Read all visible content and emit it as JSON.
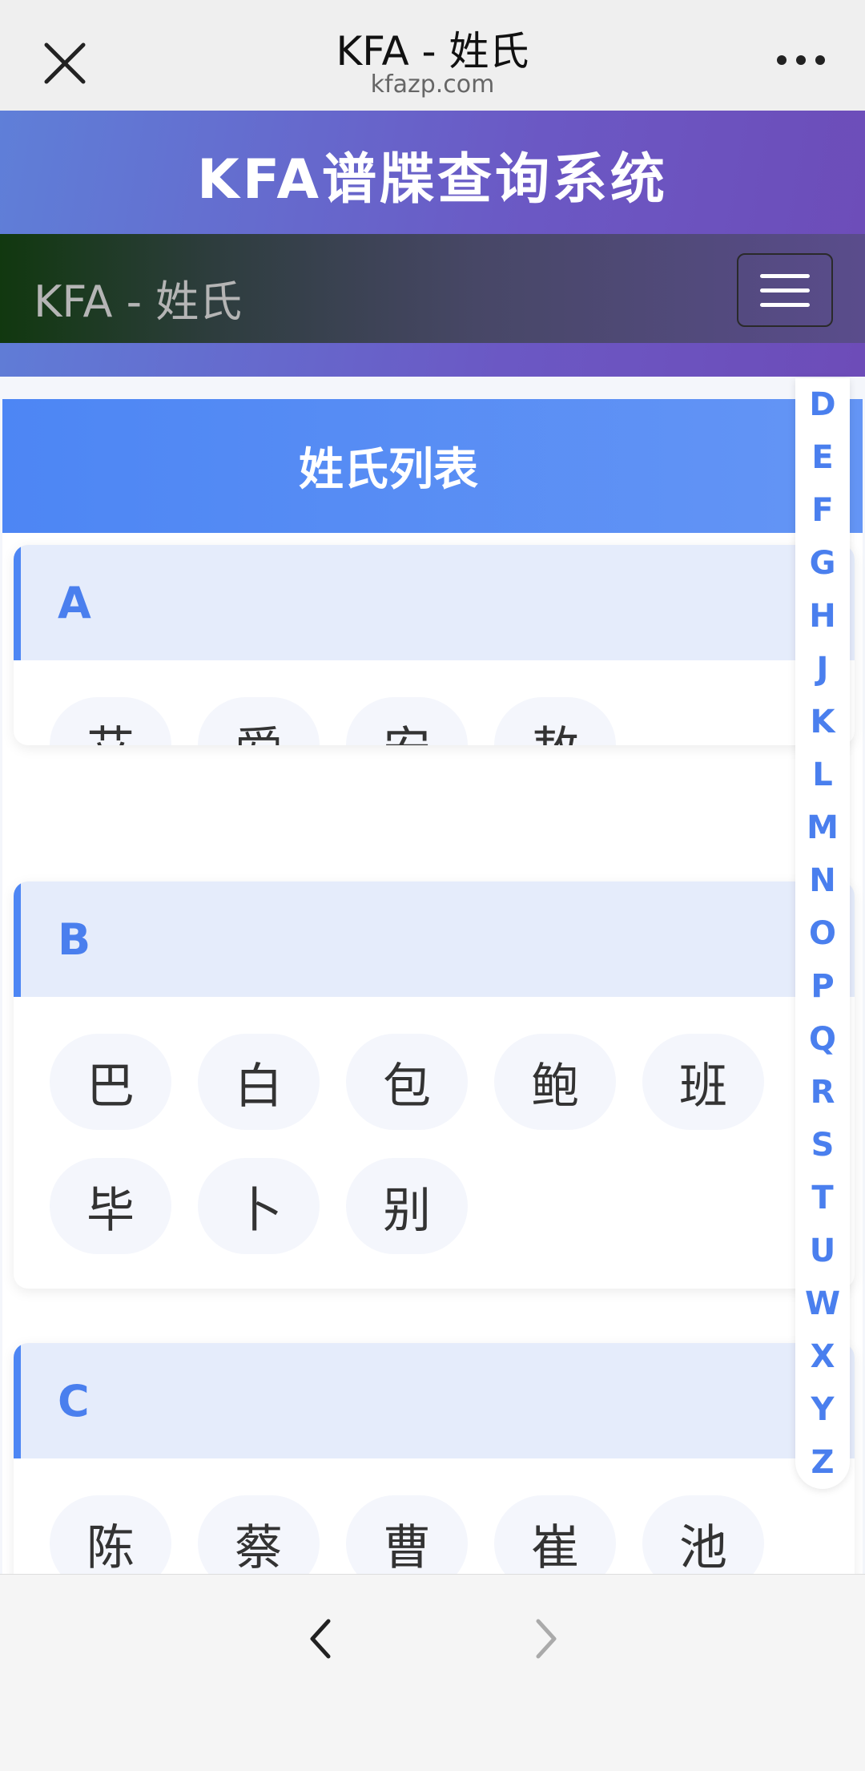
{
  "browser": {
    "title": "KFA - 姓氏",
    "url": "kfazp.com"
  },
  "header": {
    "title": "KFA谱牒查询系统",
    "navbar_brand": "KFA - 姓氏"
  },
  "list": {
    "title": "姓氏列表",
    "sections": [
      {
        "letter": "A",
        "names": [
          "艾",
          "爱",
          "安",
          "敖"
        ]
      },
      {
        "letter": "B",
        "names": [
          "巴",
          "白",
          "包",
          "鲍",
          "班",
          "毕",
          "卜",
          "别"
        ]
      },
      {
        "letter": "C",
        "names": [
          "陈",
          "蔡",
          "曹",
          "崔",
          "池"
        ]
      }
    ]
  },
  "alpha_index": [
    "D",
    "E",
    "F",
    "G",
    "H",
    "J",
    "K",
    "L",
    "M",
    "N",
    "O",
    "P",
    "Q",
    "R",
    "S",
    "T",
    "U",
    "W",
    "X",
    "Y",
    "Z"
  ],
  "colors": {
    "accent": "#4a7fee",
    "header_start": "#5f7fd8",
    "header_end": "#6d4cb8"
  },
  "icons": {
    "close": "close-icon",
    "more": "more-icon",
    "back": "chevron-left-icon",
    "forward": "chevron-right-icon",
    "menu": "hamburger-icon"
  }
}
